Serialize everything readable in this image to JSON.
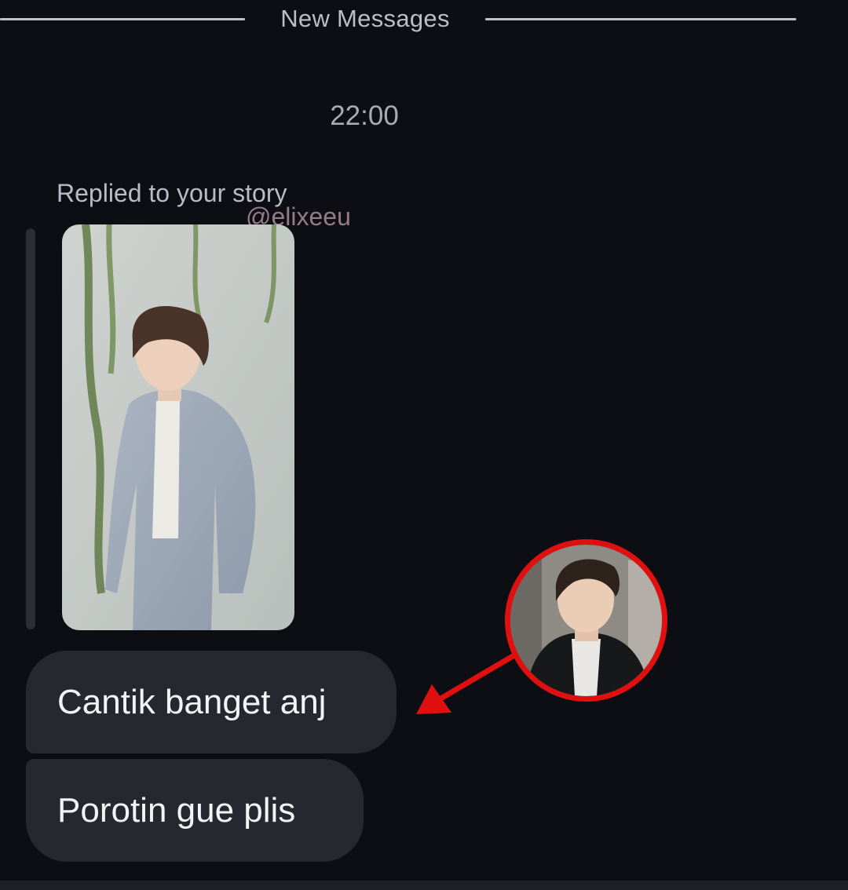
{
  "divider": {
    "label": "New Messages"
  },
  "conversation": {
    "timestamp": "22:00",
    "story_reply": {
      "label": "Replied to your story",
      "watermark": "@elixeeu"
    },
    "messages": [
      {
        "text": "Cantik banget anj"
      },
      {
        "text": "Porotin gue plis"
      }
    ]
  },
  "annotation": {
    "highlight_color": "#e01010"
  },
  "colors": {
    "background": "#0c0e13",
    "bubble": "#25282e",
    "bubble_text": "#f2f3f5",
    "muted_text": "#b7bcc6"
  }
}
